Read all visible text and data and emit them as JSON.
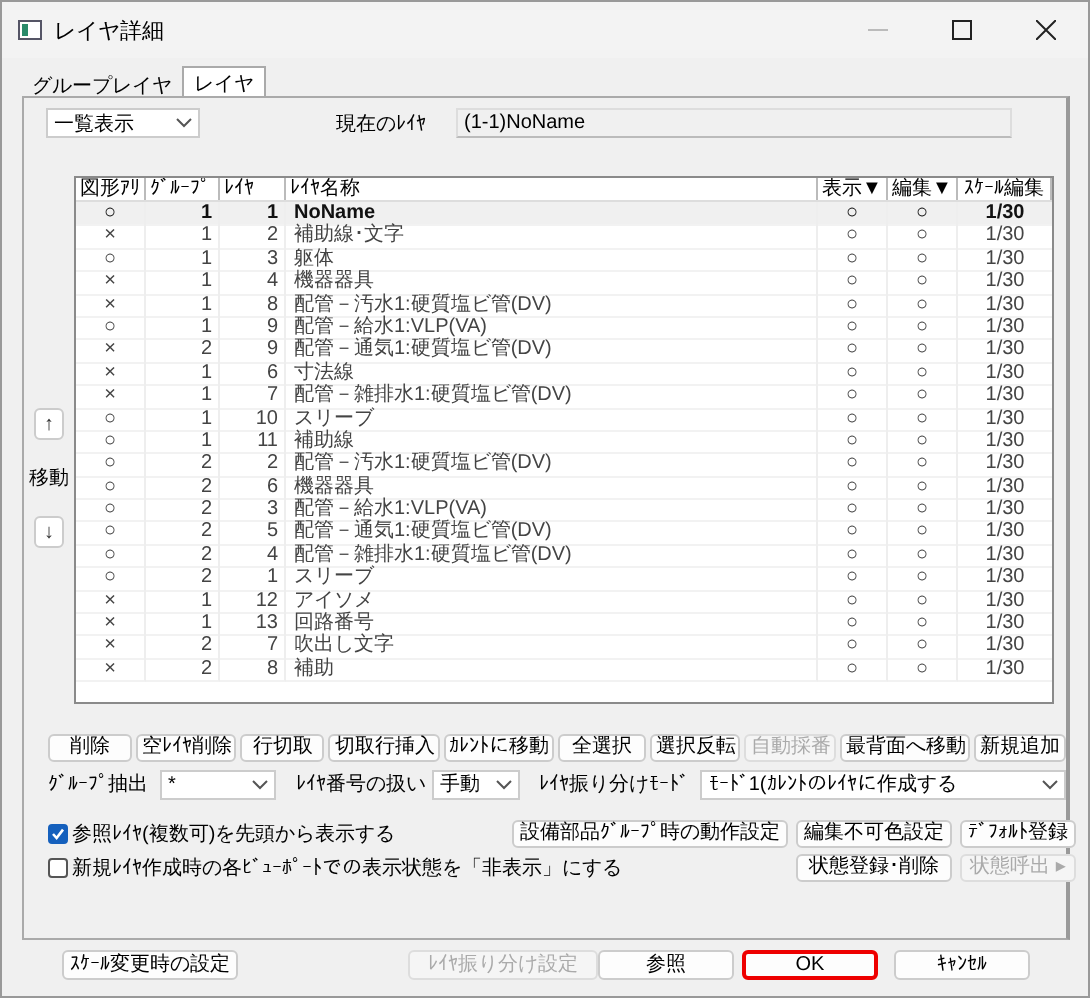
{
  "window": {
    "title": "レイヤ詳細"
  },
  "tabs": [
    {
      "label": "グループレイヤ",
      "selected": false
    },
    {
      "label": "レイヤ",
      "selected": true
    }
  ],
  "view_select": {
    "value": "一覧表示"
  },
  "current_layer": {
    "label": "現在のﾚｲﾔ",
    "value": "(1-1)NoName"
  },
  "move": {
    "up": "↑",
    "label": "移動",
    "down": "↓"
  },
  "table": {
    "columns": [
      "図形ｱﾘ",
      "ｸﾞﾙｰﾌﾟ",
      "ﾚｲﾔ",
      "ﾚｲﾔ名称",
      "表示▼",
      "編集▼",
      "ｽｹｰﾙ編集"
    ],
    "rows": [
      {
        "shape": "○",
        "group": "1",
        "layer": "1",
        "name": "NoName",
        "display": "○",
        "edit": "○",
        "scale": "1/30",
        "selected": true
      },
      {
        "shape": "×",
        "group": "1",
        "layer": "2",
        "name": "補助線･文字",
        "display": "○",
        "edit": "○",
        "scale": "1/30",
        "selected": false
      },
      {
        "shape": "○",
        "group": "1",
        "layer": "3",
        "name": "躯体",
        "display": "○",
        "edit": "○",
        "scale": "1/30",
        "selected": false
      },
      {
        "shape": "×",
        "group": "1",
        "layer": "4",
        "name": "機器器具",
        "display": "○",
        "edit": "○",
        "scale": "1/30",
        "selected": false
      },
      {
        "shape": "×",
        "group": "1",
        "layer": "8",
        "name": "配管－汚水1:硬質塩ビ管(DV)",
        "display": "○",
        "edit": "○",
        "scale": "1/30",
        "selected": false
      },
      {
        "shape": "○",
        "group": "1",
        "layer": "9",
        "name": "配管－給水1:VLP(VA)",
        "display": "○",
        "edit": "○",
        "scale": "1/30",
        "selected": false
      },
      {
        "shape": "×",
        "group": "2",
        "layer": "9",
        "name": "配管－通気1:硬質塩ビ管(DV)",
        "display": "○",
        "edit": "○",
        "scale": "1/30",
        "selected": false
      },
      {
        "shape": "×",
        "group": "1",
        "layer": "6",
        "name": "寸法線",
        "display": "○",
        "edit": "○",
        "scale": "1/30",
        "selected": false
      },
      {
        "shape": "×",
        "group": "1",
        "layer": "7",
        "name": "配管－雑排水1:硬質塩ビ管(DV)",
        "display": "○",
        "edit": "○",
        "scale": "1/30",
        "selected": false
      },
      {
        "shape": "○",
        "group": "1",
        "layer": "10",
        "name": "スリーブ",
        "display": "○",
        "edit": "○",
        "scale": "1/30",
        "selected": false
      },
      {
        "shape": "○",
        "group": "1",
        "layer": "11",
        "name": "補助線",
        "display": "○",
        "edit": "○",
        "scale": "1/30",
        "selected": false
      },
      {
        "shape": "○",
        "group": "2",
        "layer": "2",
        "name": "配管－汚水1:硬質塩ビ管(DV)",
        "display": "○",
        "edit": "○",
        "scale": "1/30",
        "selected": false
      },
      {
        "shape": "○",
        "group": "2",
        "layer": "6",
        "name": "機器器具",
        "display": "○",
        "edit": "○",
        "scale": "1/30",
        "selected": false
      },
      {
        "shape": "○",
        "group": "2",
        "layer": "3",
        "name": "配管－給水1:VLP(VA)",
        "display": "○",
        "edit": "○",
        "scale": "1/30",
        "selected": false
      },
      {
        "shape": "○",
        "group": "2",
        "layer": "5",
        "name": "配管－通気1:硬質塩ビ管(DV)",
        "display": "○",
        "edit": "○",
        "scale": "1/30",
        "selected": false
      },
      {
        "shape": "○",
        "group": "2",
        "layer": "4",
        "name": "配管－雑排水1:硬質塩ビ管(DV)",
        "display": "○",
        "edit": "○",
        "scale": "1/30",
        "selected": false
      },
      {
        "shape": "○",
        "group": "2",
        "layer": "1",
        "name": "スリーブ",
        "display": "○",
        "edit": "○",
        "scale": "1/30",
        "selected": false
      },
      {
        "shape": "×",
        "group": "1",
        "layer": "12",
        "name": "アイソメ",
        "display": "○",
        "edit": "○",
        "scale": "1/30",
        "selected": false
      },
      {
        "shape": "×",
        "group": "1",
        "layer": "13",
        "name": "回路番号",
        "display": "○",
        "edit": "○",
        "scale": "1/30",
        "selected": false
      },
      {
        "shape": "×",
        "group": "2",
        "layer": "7",
        "name": "吹出し文字",
        "display": "○",
        "edit": "○",
        "scale": "1/30",
        "selected": false
      },
      {
        "shape": "×",
        "group": "2",
        "layer": "8",
        "name": "補助",
        "display": "○",
        "edit": "○",
        "scale": "1/30",
        "selected": false
      }
    ]
  },
  "action_buttons": [
    {
      "label": "削除",
      "disabled": false
    },
    {
      "label": "空ﾚｲﾔ削除",
      "disabled": false
    },
    {
      "label": "行切取",
      "disabled": false
    },
    {
      "label": "切取行挿入",
      "disabled": false
    },
    {
      "label": "ｶﾚﾝﾄに移動",
      "disabled": false
    },
    {
      "label": "全選択",
      "disabled": false
    },
    {
      "label": "選択反転",
      "disabled": false
    },
    {
      "label": "自動採番",
      "disabled": true
    },
    {
      "label": "最背面へ移動",
      "disabled": false
    },
    {
      "label": "新規追加",
      "disabled": false
    }
  ],
  "group_filter": {
    "label": "ｸﾞﾙｰﾌﾟ抽出",
    "value": "*"
  },
  "layer_numbering": {
    "label": "ﾚｲﾔ番号の扱い",
    "value": "手動"
  },
  "assign_mode": {
    "label": "ﾚｲﾔ振り分けﾓｰﾄﾞ",
    "value": "ﾓｰﾄﾞ1(ｶﾚﾝﾄのﾚｲﾔに作成する"
  },
  "checkboxes": [
    {
      "label": "参照ﾚｲﾔ(複数可)を先頭から表示する",
      "checked": true
    },
    {
      "label": "新規ﾚｲﾔ作成時の各ﾋﾞｭｰﾎﾟｰﾄでの表示状態を「非表示」にする",
      "checked": false
    }
  ],
  "setting_buttons": [
    {
      "label": "設備部品ｸﾞﾙｰﾌﾟ時の動作設定",
      "disabled": false
    },
    {
      "label": "編集不可色設定",
      "disabled": false
    },
    {
      "label": "ﾃﾞﾌｫﾙﾄ登録",
      "disabled": false
    },
    {
      "label": "状態登録･削除",
      "disabled": false
    },
    {
      "label": "状態呼出 ▸",
      "disabled": true
    }
  ],
  "footer_buttons": [
    {
      "label": "ｽｹｰﾙ変更時の設定",
      "disabled": false,
      "focused": false
    },
    {
      "label": "ﾚｲﾔ振り分け設定",
      "disabled": true,
      "focused": false
    },
    {
      "label": "参照",
      "disabled": false,
      "focused": false
    },
    {
      "label": "OK",
      "disabled": false,
      "focused": true
    },
    {
      "label": "ｷｬﾝｾﾙ",
      "disabled": false,
      "focused": false
    }
  ]
}
